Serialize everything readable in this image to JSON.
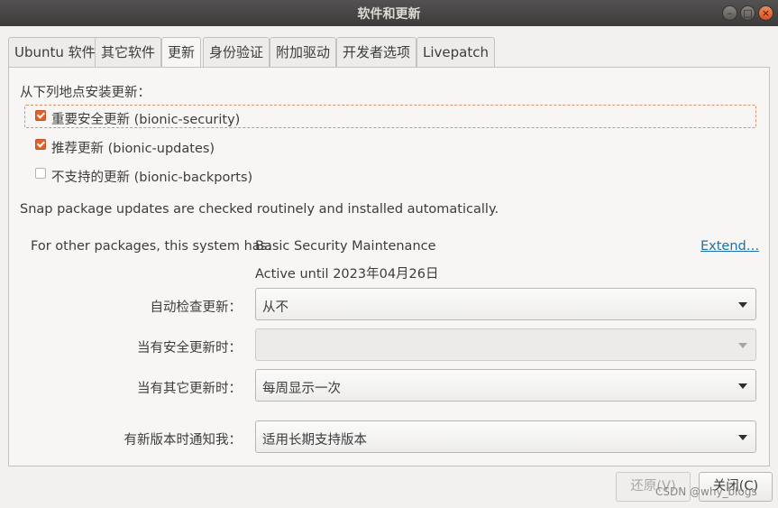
{
  "window": {
    "title": "软件和更新"
  },
  "tabs": [
    {
      "label": "Ubuntu 软件"
    },
    {
      "label": "其它软件"
    },
    {
      "label": "更新"
    },
    {
      "label": "身份验证"
    },
    {
      "label": "附加驱动"
    },
    {
      "label": "开发者选项"
    },
    {
      "label": "Livepatch"
    }
  ],
  "active_tab": "更新",
  "updates": {
    "section_label": "从下列地点安装更新：",
    "sources": [
      {
        "label": "重要安全更新 (bionic-security)",
        "checked": true
      },
      {
        "label": "推荐更新 (bionic-updates)",
        "checked": true
      },
      {
        "label": "不支持的更新 (bionic-backports)",
        "checked": false
      }
    ],
    "snap_note": "Snap package updates are checked routinely and installed automatically.",
    "support_label": "For other packages, this system has:",
    "support_value": "Basic Security Maintenance",
    "support_until": "Active until 2023年04月26日",
    "extend_link": "Extend…",
    "auto_check_label": "自动检查更新：",
    "auto_check_value": "从不",
    "security_label": "当有安全更新时：",
    "security_value": "",
    "other_label": "当有其它更新时：",
    "other_value": "每周显示一次",
    "notify_label": "有新版本时通知我：",
    "notify_value": "适用长期支持版本"
  },
  "buttons": {
    "revert": "还原(V)",
    "close": "关闭(C)"
  },
  "watermark": "CSDN @why_blogs",
  "colors": {
    "accent": "#e0622b",
    "link": "#1a73a8"
  }
}
